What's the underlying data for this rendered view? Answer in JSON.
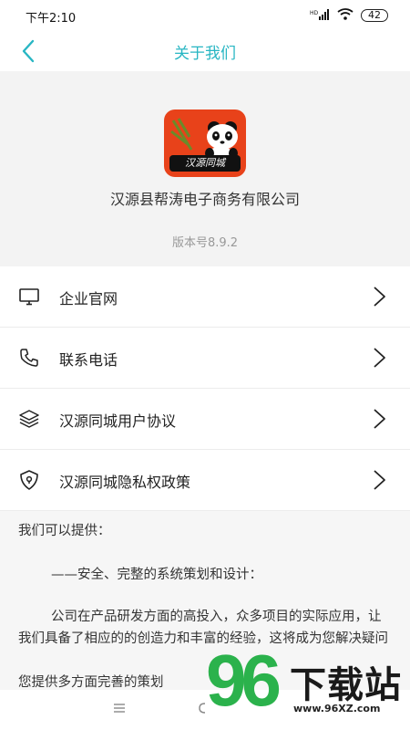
{
  "status_bar": {
    "time": "下午2:10",
    "network": "HD",
    "battery": "42"
  },
  "nav": {
    "title": "关于我们"
  },
  "header": {
    "company": "汉源县帮涛电子商务有限公司",
    "version": "版本号8.9.2",
    "logo_text": "汉源同城"
  },
  "menu": {
    "items": [
      {
        "label": "企业官网",
        "icon": "monitor-icon"
      },
      {
        "label": "联系电话",
        "icon": "phone-icon"
      },
      {
        "label": "汉源同城用户协议",
        "icon": "layers-icon"
      },
      {
        "label": "汉源同城隐私权政策",
        "icon": "shield-icon"
      }
    ]
  },
  "content": {
    "intro": "我们可以提供：",
    "line1": "——安全、完整的系统策划和设计：",
    "para1": "公司在产品研发方面的高投入，众多项目的实际应用，让我们具备了相应的的创造力和丰富的经验，这将成为您解决疑问",
    "para1_tail": "您提供多方面完善的策划"
  },
  "watermark": {
    "brand": "下载站",
    "number": "96",
    "url": "www.96XZ.com"
  },
  "colors": {
    "accent": "#28b6c3",
    "logo_bg": "#e8421a",
    "watermark_green": "#2bb24c"
  }
}
